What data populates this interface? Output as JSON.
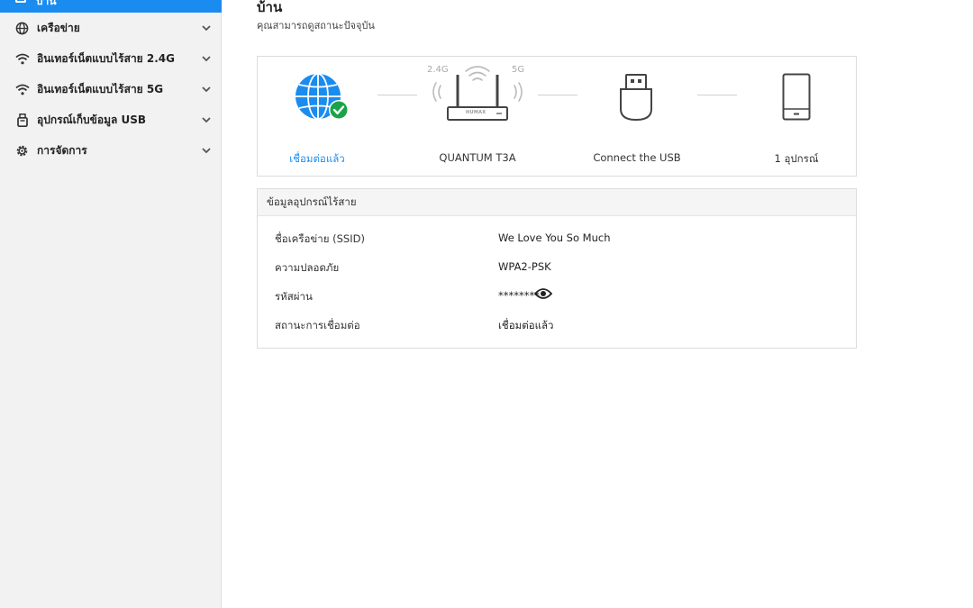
{
  "sidebar": {
    "active_label": "บ้าน",
    "items": [
      {
        "label": "เครือข่าย",
        "icon": "globe-icon"
      },
      {
        "label": "อินเทอร์เน็ตแบบไร้สาย 2.4G",
        "icon": "wifi-icon"
      },
      {
        "label": "อินเทอร์เน็ตแบบไร้สาย 5G",
        "icon": "wifi-icon"
      },
      {
        "label": "อุปกรณ์เก็บข้อมูล USB",
        "icon": "usb-drive-icon"
      },
      {
        "label": "การจัดการ",
        "icon": "gear-icon"
      }
    ]
  },
  "page": {
    "title": "บ้าน",
    "subtitle": "คุณสามารถดูสถานะปัจจุบัน"
  },
  "topology": {
    "internet_label": "เชื่อมต่อแล้ว",
    "router_label": "QUANTUM T3A",
    "router_brand": "HUMAX",
    "band_24": "2.4G",
    "band_5": "5G",
    "usb_label": "Connect the USB",
    "devices_label": "1 อุปกรณ์"
  },
  "wireless_info": {
    "header": "ข้อมูลอุปกรณ์ไร้สาย",
    "rows": [
      {
        "key": "ชื่อเครือข่าย (SSID)",
        "value": "We Love You So Much"
      },
      {
        "key": "ความปลอดภัย",
        "value": "WPA2-PSK"
      },
      {
        "key": "รหัสผ่าน",
        "value": "********"
      },
      {
        "key": "สถานะการเชื่อมต่อ",
        "value": "เชื่อมต่อแล้ว"
      }
    ]
  },
  "colors": {
    "accent": "#1a8cf0",
    "success": "#1aa34a",
    "sidebar_bg": "#f2f2f2"
  }
}
